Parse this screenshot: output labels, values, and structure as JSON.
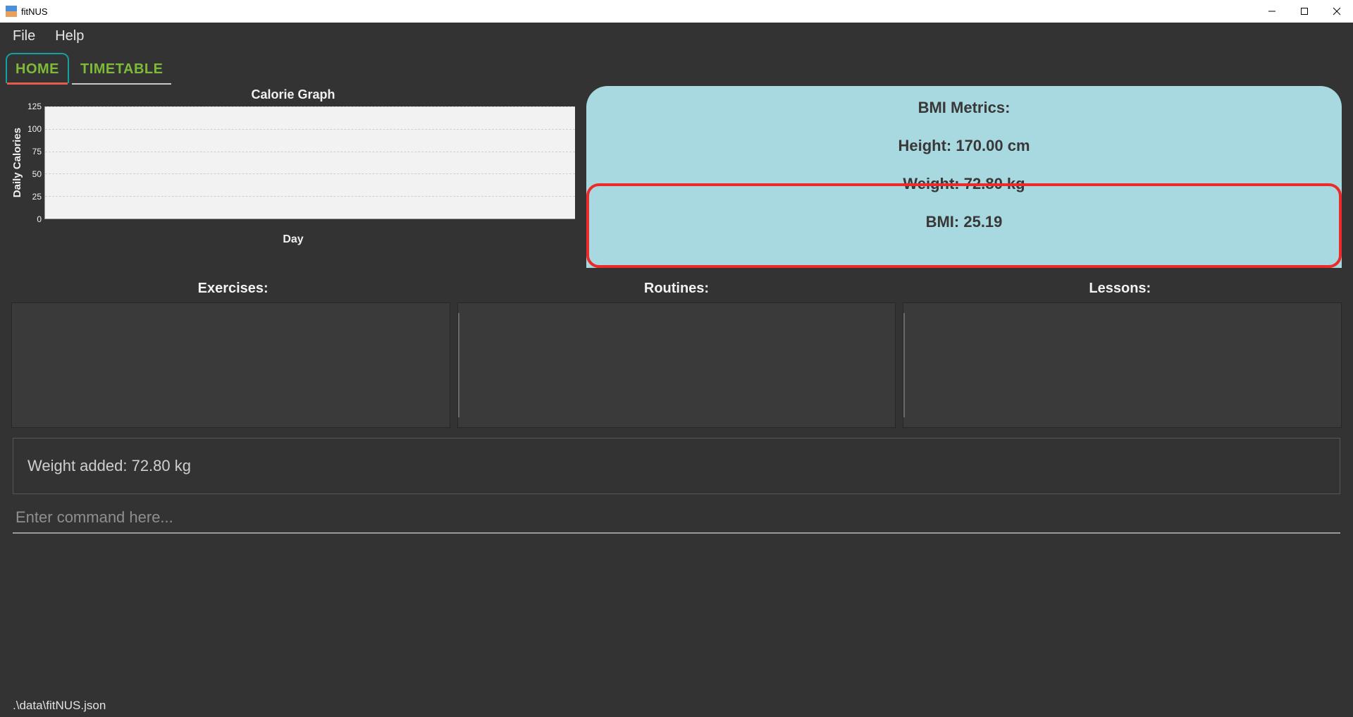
{
  "window": {
    "title": "fitNUS"
  },
  "menu": {
    "file": "File",
    "help": "Help"
  },
  "tabs": {
    "home": "HOME",
    "timetable": "TIMETABLE"
  },
  "chart": {
    "title": "Calorie Graph",
    "ylabel": "Daily Calories",
    "xlabel": "Day"
  },
  "chart_data": {
    "type": "bar",
    "categories": [],
    "values": [],
    "title": "Calorie Graph",
    "xlabel": "Day",
    "ylabel": "Daily Calories",
    "ylim": [
      0,
      125
    ],
    "yticks": [
      0,
      25,
      50,
      75,
      100,
      125
    ]
  },
  "bmi": {
    "title": "BMI Metrics:",
    "height": "Height: 170.00 cm",
    "weight": "Weight: 72.80 kg",
    "bmi": "BMI: 25.19"
  },
  "columns": {
    "exercises": "Exercises:",
    "routines": "Routines:",
    "lessons": "Lessons:"
  },
  "feedback": "Weight added: 72.80 kg",
  "command": {
    "placeholder": "Enter command here..."
  },
  "status": ".\\data\\fitNUS.json"
}
